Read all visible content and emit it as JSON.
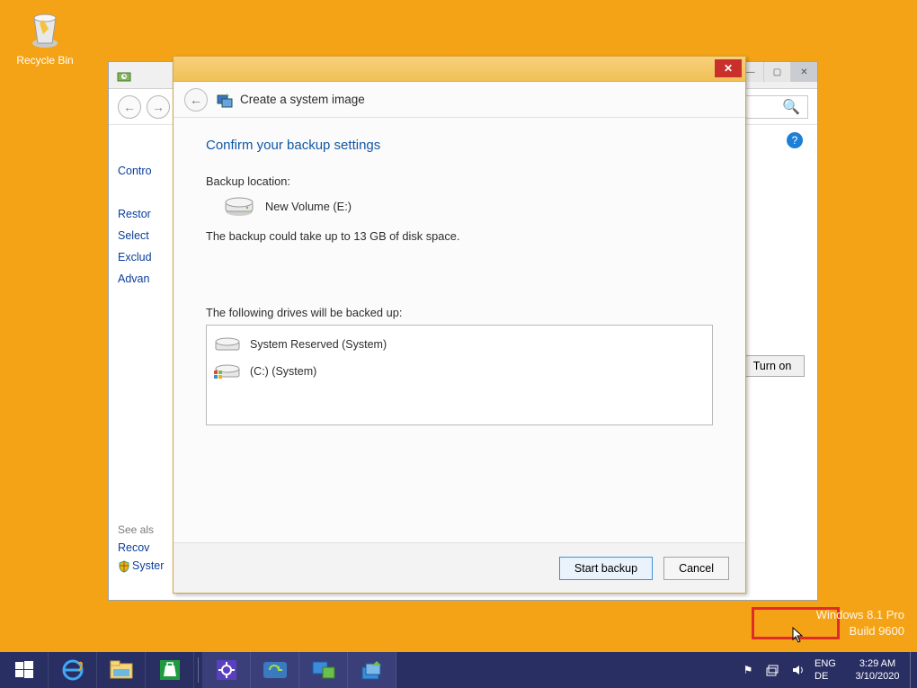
{
  "desktop": {
    "recycle_bin_label": "Recycle Bin"
  },
  "bg_window": {
    "sidebar": {
      "items": [
        {
          "label": "Contro"
        },
        {
          "label": "Restor"
        },
        {
          "label": "Select"
        },
        {
          "label": "Exclud"
        },
        {
          "label": "Advan"
        }
      ],
      "see_also_header": "See als",
      "see_also": [
        {
          "label": "Recov"
        },
        {
          "label": "Syster"
        }
      ]
    },
    "turn_on_label": "Turn on"
  },
  "wizard": {
    "title": "Create a system image",
    "heading": "Confirm your backup settings",
    "backup_location_label": "Backup location:",
    "backup_location_value": "New Volume (E:)",
    "disk_note": "The backup could take up to 13 GB of disk space.",
    "drives_label": "The following drives will be backed up:",
    "drives": [
      {
        "label": "System Reserved (System)"
      },
      {
        "label": "(C:) (System)"
      }
    ],
    "buttons": {
      "start": "Start backup",
      "cancel": "Cancel"
    }
  },
  "watermark": {
    "line1": "Windows 8.1 Pro",
    "line2": "Build 9600"
  },
  "taskbar": {
    "lang": {
      "line1": "ENG",
      "line2": "DE"
    },
    "clock": {
      "time": "3:29 AM",
      "date": "3/10/2020"
    }
  }
}
